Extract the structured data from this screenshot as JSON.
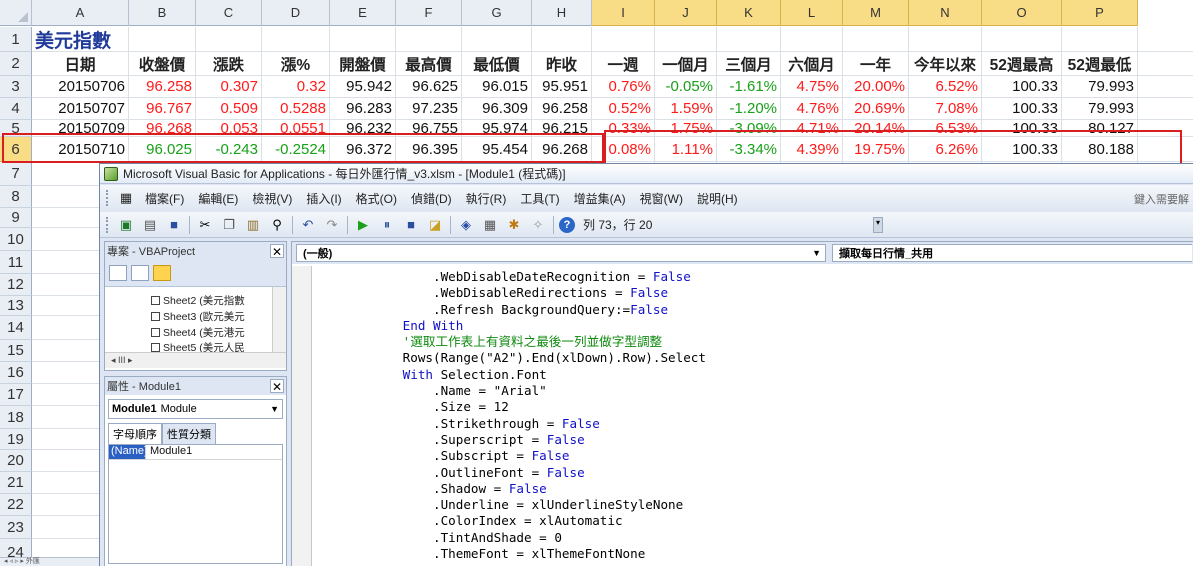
{
  "excel": {
    "columns": [
      "A",
      "B",
      "C",
      "D",
      "E",
      "F",
      "G",
      "H",
      "I",
      "J",
      "K",
      "L",
      "M",
      "N",
      "O",
      "P"
    ],
    "rows": [
      "1",
      "2",
      "3",
      "4",
      "5",
      "6",
      "7",
      "8",
      "9",
      "10",
      "11",
      "12",
      "13",
      "14",
      "15",
      "16",
      "17",
      "18",
      "19",
      "20",
      "21",
      "22",
      "23",
      "24"
    ],
    "title": "美元指數",
    "headers": [
      "日期",
      "收盤價",
      "漲跌",
      "漲%",
      "開盤價",
      "最高價",
      "最低價",
      "昨收",
      "一週",
      "一個月",
      "三個月",
      "六個月",
      "一年",
      "今年以來",
      "52週最高",
      "52週最低"
    ],
    "data": [
      [
        "20150706",
        "96.258",
        "0.307",
        "0.32",
        "95.942",
        "96.625",
        "96.015",
        "95.951",
        "0.76%",
        "-0.05%",
        "-1.61%",
        "4.75%",
        "20.00%",
        "6.52%",
        "100.33",
        "79.993"
      ],
      [
        "20150707",
        "96.767",
        "0.509",
        "0.5288",
        "96.283",
        "97.235",
        "96.309",
        "96.258",
        "0.52%",
        "1.59%",
        "-1.20%",
        "4.76%",
        "20.69%",
        "7.08%",
        "100.33",
        "79.993"
      ],
      [
        "20150709",
        "96.268",
        "0.053",
        "0.0551",
        "96.232",
        "96.755",
        "95.974",
        "96.215",
        "0.33%",
        "1.75%",
        "-3.09%",
        "4.71%",
        "20.14%",
        "6.53%",
        "100.33",
        "80.127"
      ],
      [
        "20150710",
        "96.025",
        "-0.243",
        "-0.2524",
        "96.372",
        "96.395",
        "95.454",
        "96.268",
        "0.08%",
        "1.11%",
        "-3.34%",
        "4.39%",
        "19.75%",
        "6.26%",
        "100.33",
        "80.188"
      ]
    ],
    "sheet_tab_fragment": "外匯"
  },
  "vbe": {
    "title": "Microsoft Visual Basic for Applications - 每日外匯行情_v3.xlsm - [Module1 (程式碼)]",
    "menu": [
      "檔案(F)",
      "編輯(E)",
      "檢視(V)",
      "插入(I)",
      "格式(O)",
      "偵錯(D)",
      "執行(R)",
      "工具(T)",
      "增益集(A)",
      "視窗(W)",
      "說明(H)"
    ],
    "help_hint": "鍵入需要解",
    "cursor_pos": "列 73，行 20",
    "project": {
      "title": "專案 - VBAProject",
      "items": [
        "Sheet2 (美元指數",
        "Sheet3 (歐元美元",
        "Sheet4 (美元港元",
        "Sheet5 (美元人民"
      ],
      "scroll_label": "III"
    },
    "properties": {
      "title": "屬性 - Module1",
      "object_name": "Module1",
      "object_type": "Module",
      "tabs": [
        "字母順序",
        "性質分類"
      ],
      "key": "(Name)",
      "value": "Module1"
    },
    "code": {
      "object_combo": "(一般)",
      "proc_combo": "擷取每日行情_共用",
      "lines": [
        {
          "indent": "            ",
          "kw": "",
          "rest": ".WebDisableDateRecognition = ",
          "kw2": "False",
          "cls": ""
        },
        {
          "indent": "            ",
          "kw": "",
          "rest": ".WebDisableRedirections = ",
          "kw2": "False",
          "cls": ""
        },
        {
          "indent": "            ",
          "kw": "",
          "rest": ".Refresh BackgroundQuery:=",
          "kw2": "False",
          "cls": ""
        },
        {
          "indent": "        ",
          "kw": "End With",
          "rest": "",
          "kw2": "",
          "cls": ""
        },
        {
          "indent": "        ",
          "kw": "",
          "rest": "'選取工作表上有資料之最後一列並做字型調整",
          "kw2": "",
          "cls": "cm"
        },
        {
          "indent": "        ",
          "kw": "",
          "rest": "Rows(Range(\"A2\").End(xlDown).Row).Select",
          "kw2": "",
          "cls": ""
        },
        {
          "indent": "        ",
          "kw": "With",
          "rest": " Selection.Font",
          "kw2": "",
          "cls": ""
        },
        {
          "indent": "            ",
          "kw": "",
          "rest": ".Name = \"Arial\"",
          "kw2": "",
          "cls": ""
        },
        {
          "indent": "            ",
          "kw": "",
          "rest": ".Size = 12",
          "kw2": "",
          "cls": ""
        },
        {
          "indent": "            ",
          "kw": "",
          "rest": ".Strikethrough = ",
          "kw2": "False",
          "cls": ""
        },
        {
          "indent": "            ",
          "kw": "",
          "rest": ".Superscript = ",
          "kw2": "False",
          "cls": ""
        },
        {
          "indent": "            ",
          "kw": "",
          "rest": ".Subscript = ",
          "kw2": "False",
          "cls": ""
        },
        {
          "indent": "            ",
          "kw": "",
          "rest": ".OutlineFont = ",
          "kw2": "False",
          "cls": ""
        },
        {
          "indent": "            ",
          "kw": "",
          "rest": ".Shadow = ",
          "kw2": "False",
          "cls": ""
        },
        {
          "indent": "            ",
          "kw": "",
          "rest": ".Underline = xlUnderlineStyleNone",
          "kw2": "",
          "cls": ""
        },
        {
          "indent": "            ",
          "kw": "",
          "rest": ".ColorIndex = xlAutomatic",
          "kw2": "",
          "cls": ""
        },
        {
          "indent": "            ",
          "kw": "",
          "rest": ".TintAndShade = 0",
          "kw2": "",
          "cls": ""
        },
        {
          "indent": "            ",
          "kw": "",
          "rest": ".ThemeFont = xlThemeFontNone",
          "kw2": "",
          "cls": ""
        }
      ]
    }
  },
  "colors": {
    "up": "#ff1a1a",
    "down": "#18a018",
    "highlight": "#d81e1e",
    "title": "#1f3a9a"
  }
}
